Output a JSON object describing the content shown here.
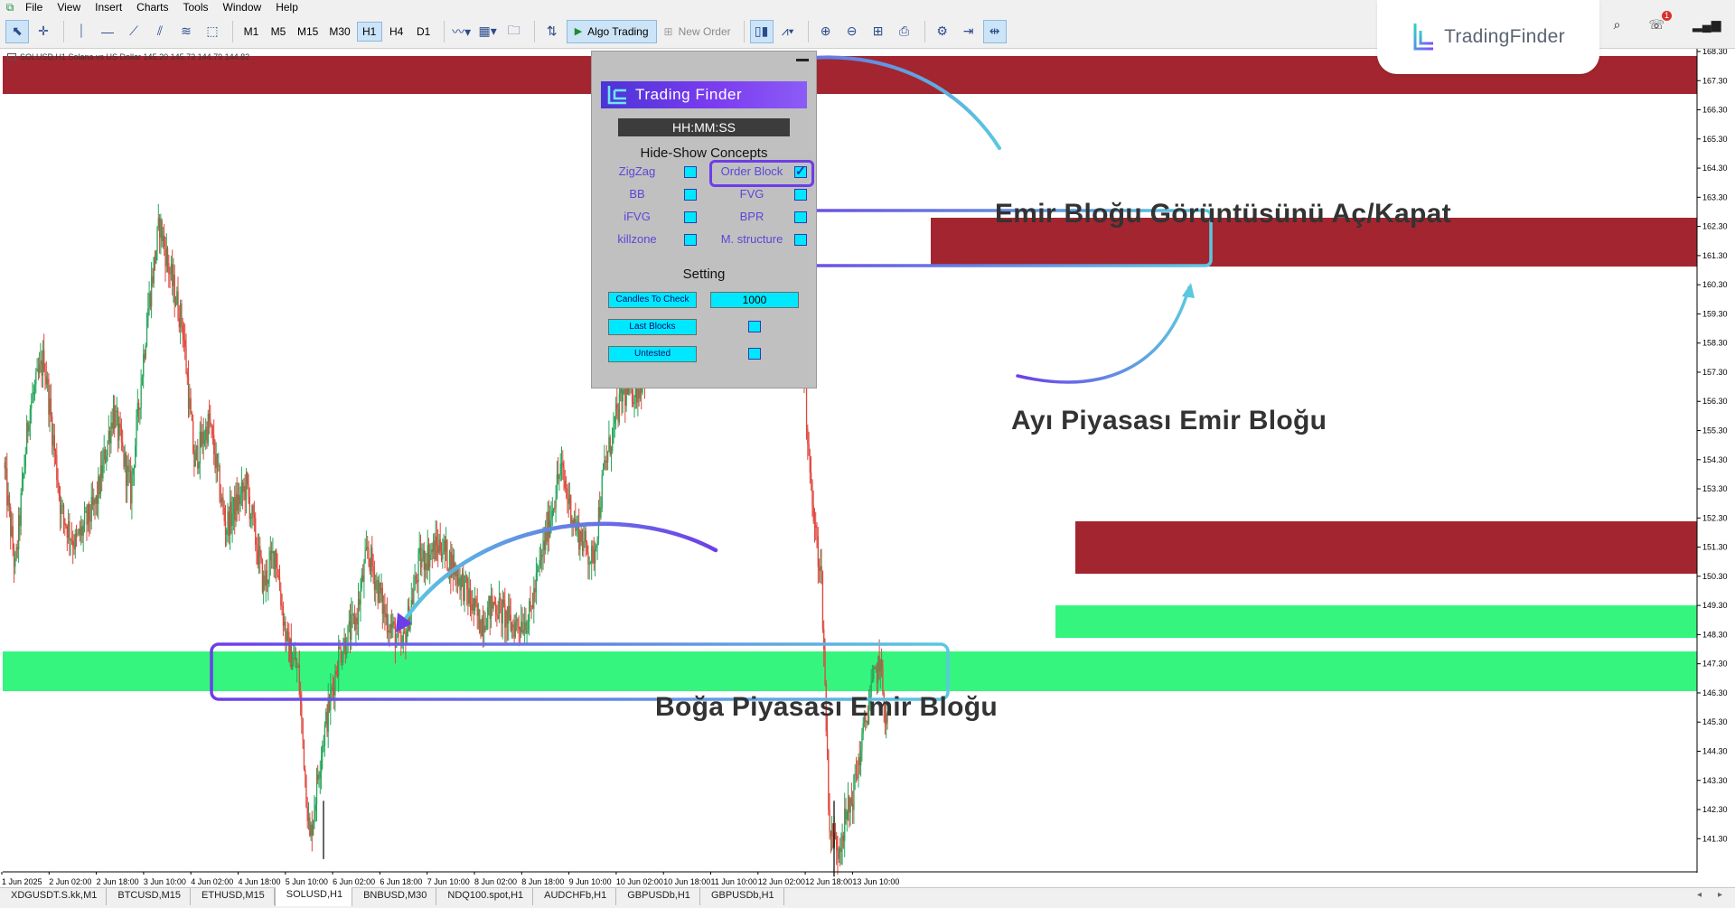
{
  "menu": [
    "File",
    "View",
    "Insert",
    "Charts",
    "Tools",
    "Window",
    "Help"
  ],
  "toolbar": {
    "timeframes": [
      "M1",
      "M5",
      "M15",
      "M30",
      "H1",
      "H4",
      "D1"
    ],
    "active_timeframe": "H1",
    "algo_trading_label": "Algo Trading",
    "new_order_label": "New Order"
  },
  "brand": {
    "logo_text": "TradingFinder"
  },
  "notifications": {
    "count": "1"
  },
  "chart": {
    "info_text": "SOLUSD,H1  Solana vs US Dollar  145.20 145.73 144.79 144.82",
    "price_labels": [
      "168.30",
      "167.30",
      "166.30",
      "165.30",
      "164.30",
      "163.30",
      "162.30",
      "161.30",
      "160.30",
      "159.30",
      "158.30",
      "157.30",
      "156.30",
      "155.30",
      "154.30",
      "153.30",
      "152.30",
      "151.30",
      "150.30",
      "149.30",
      "148.30",
      "147.30",
      "146.30",
      "145.30",
      "144.30",
      "143.30",
      "142.30",
      "141.30"
    ],
    "time_labels": [
      "1 Jun 2025",
      "2 Jun 02:00",
      "2 Jun 18:00",
      "3 Jun 10:00",
      "4 Jun 02:00",
      "4 Jun 18:00",
      "5 Jun 10:00",
      "6 Jun 02:00",
      "6 Jun 18:00",
      "7 Jun 10:00",
      "8 Jun 02:00",
      "8 Jun 18:00",
      "9 Jun 10:00",
      "10 Jun 02:00",
      "10 Jun 18:00",
      "11 Jun 10:00",
      "12 Jun 02:00",
      "12 Jun 18:00",
      "13 Jun 10:00"
    ],
    "colors": {
      "bull": "#26a65b",
      "bear": "#e0463c",
      "bearish_block": "#a3252f",
      "bullish_block": "#35f57e",
      "annotation_purple": "#6d3ee8",
      "annotation_cyan": "#5bc8e0"
    }
  },
  "panel": {
    "logo_text": "Trading Finder",
    "clock": "HH:MM:SS",
    "concepts_title": "Hide-Show Concepts",
    "concepts": [
      {
        "label": "ZigZag",
        "checked": false
      },
      {
        "label": "Order Block",
        "checked": true
      },
      {
        "label": "BB",
        "checked": false
      },
      {
        "label": "FVG",
        "checked": false
      },
      {
        "label": "iFVG",
        "checked": false
      },
      {
        "label": "BPR",
        "checked": false
      },
      {
        "label": "killzone",
        "checked": false
      },
      {
        "label": "M. structure",
        "checked": false
      }
    ],
    "setting_title": "Setting",
    "settings": {
      "candles_to_check_label": "Candles To Check",
      "candles_to_check_value": "1000",
      "last_blocks_label": "Last Blocks",
      "untested_label": "Untested"
    }
  },
  "annotations": {
    "toggle": "Emir Bloğu Görüntüsünü Aç/Kapat",
    "bearish": "Ayı Piyasası Emir Bloğu",
    "bullish": "Boğa Piyasası Emir Bloğu"
  },
  "tabs": [
    "XDGUSDT.S.kk,M1",
    "BTCUSD,M15",
    "ETHUSD,M15",
    "SOLUSD,H1",
    "BNBUSD,M30",
    "NDQ100.spot,H1",
    "AUDCHFb,H1",
    "GBPUSDb,H1",
    "GBPUSDb,H1"
  ],
  "active_tab": "SOLUSD,H1"
}
